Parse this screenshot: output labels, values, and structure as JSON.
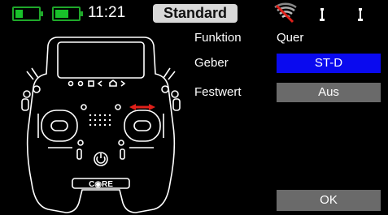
{
  "status": {
    "time": "11:21",
    "model_name": "Standard",
    "battery_tx_level": 0.35,
    "battery_rx_level": 0.6,
    "battery_color": "#18c22a"
  },
  "form": {
    "rows": [
      {
        "label": "Funktion",
        "value": "Quer"
      },
      {
        "label": "Geber",
        "value": "ST-D"
      },
      {
        "label": "Festwert",
        "value": "Aus"
      }
    ],
    "ok_label": "OK"
  },
  "transmitter": {
    "brand": "C◉RE",
    "highlight_color": "#e0201a"
  },
  "colors": {
    "accent_selected": "#0a0aef",
    "button_gray": "#6a6a6a"
  },
  "icons": [
    "battery-icon",
    "rf-signal-icon",
    "antenna-icon"
  ]
}
